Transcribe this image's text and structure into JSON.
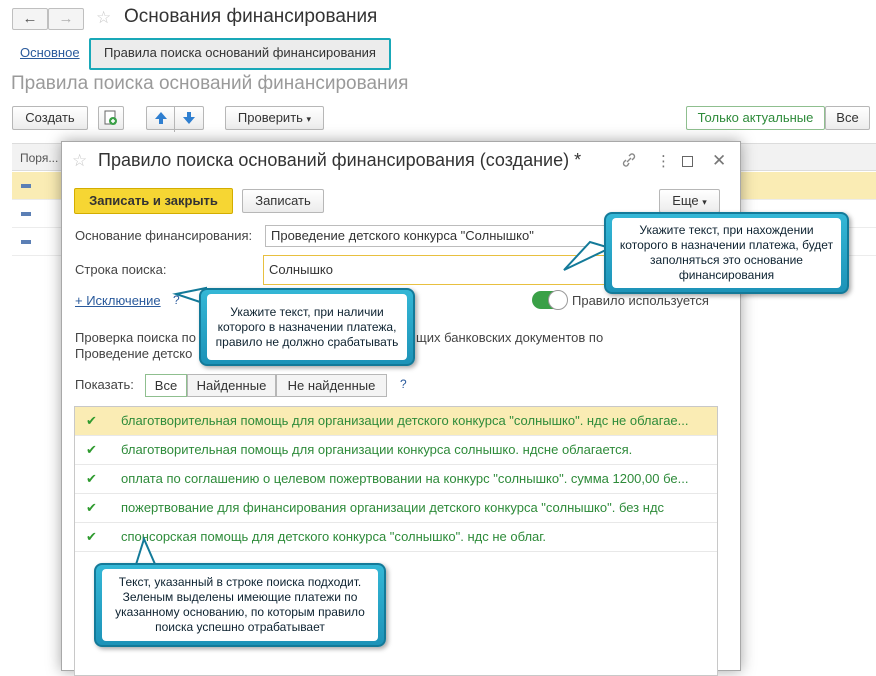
{
  "window": {
    "back_glyph": "←",
    "forward_glyph": "→",
    "title": "Основания финансирования",
    "tab_main": "Основное",
    "tab_active": "Правила поиска оснований финансирования",
    "section_title": "Правила поиска оснований финансирования"
  },
  "toolbar": {
    "create": "Создать",
    "check": "Проверить",
    "only_actual": "Только актуальные",
    "all": "Все"
  },
  "table": {
    "col_order": "Поря..."
  },
  "modal": {
    "title": "Правило поиска оснований финансирования (создание) *",
    "save_close": "Записать и закрыть",
    "save": "Записать",
    "more": "Еще",
    "basis_label": "Основание финансирования:",
    "basis_value": "Проведение детского конкурса \"Солнышко\"",
    "search_label": "Строка поиска:",
    "search_value": "Солнышко",
    "exclusion_link": "+ Исключение",
    "help_q": "?",
    "rule_used": "Правило используется",
    "check_text_1": "Проверка поиска по",
    "check_text_1b": "щих банковских документов по",
    "check_text_2": "Проведение детско",
    "show_label": "Показать:",
    "filter_all": "Все",
    "filter_found": "Найденные",
    "filter_not_found": "Не найденные",
    "check_glyph": "✔",
    "results": [
      "благотворительная помощь для организации детского конкурса \"солнышко\". ндс не облагае...",
      "благотворительная помощь для организации конкурса солнышко. ндсне облагается.",
      "оплата по соглашению о целевом пожертвовании на конкурс \"солнышко\". сумма 1200,00 бе...",
      "пожертвование для финансирования организации детского конкурса \"солнышко\". без ндс",
      "спонсорская помощь для  детского конкурса \"солнышко\". ндс не облаг."
    ]
  },
  "callouts": {
    "search_hint": "Укажите текст, при нахождении которого в назначении платежа, будет заполняться это основание финансирования",
    "exclusion_hint": "Укажите текст, при наличии которого в назначении платежа, правило не должно срабатывать",
    "result_hint": "Текст, указанный в строке поиска подходит. Зеленым выделены имеющие платежи по указанному основанию, по которым правило поиска успешно отрабатывает"
  },
  "colors": {
    "accent_teal": "#19a8b8",
    "primary_yellow": "#f6d633",
    "found_green": "#2e8b3a",
    "toggle_green": "#3aa047"
  }
}
